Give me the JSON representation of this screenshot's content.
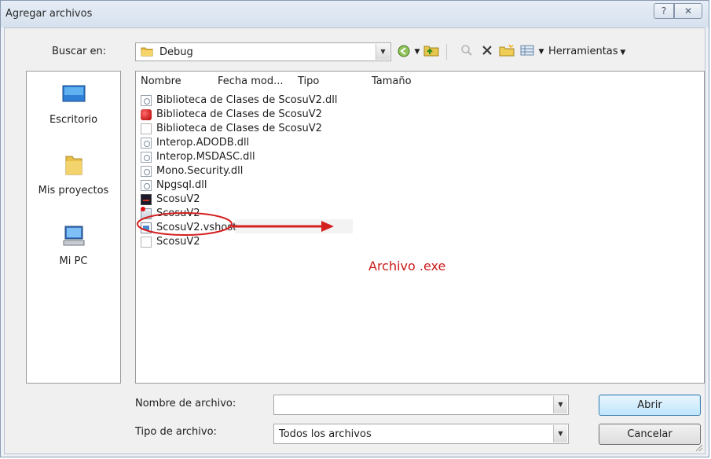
{
  "window": {
    "title": "Agregar archivos",
    "help_label": "?",
    "close_label": "✕"
  },
  "look_in": {
    "label": "Buscar en:",
    "value": "Debug"
  },
  "toolbar": {
    "tools_label": "Herramientas"
  },
  "places": [
    {
      "label": "Escritorio"
    },
    {
      "label": "Mis proyectos"
    },
    {
      "label": "Mi PC"
    }
  ],
  "columns": [
    "Nombre",
    "Fecha mod...",
    "Tipo",
    "Tamaño"
  ],
  "files": [
    {
      "name": "Biblioteca de Clases de ScosuV2.dll",
      "icon": "dll-file-icon"
    },
    {
      "name": "Biblioteca de Clases de ScosuV2",
      "icon": "debug-symbols-icon"
    },
    {
      "name": "Biblioteca de Clases de ScosuV2",
      "icon": "blank-file-icon"
    },
    {
      "name": "Interop.ADODB.dll",
      "icon": "dll-file-icon"
    },
    {
      "name": "Interop.MSDASC.dll",
      "icon": "dll-file-icon"
    },
    {
      "name": "Mono.Security.dll",
      "icon": "dll-file-icon"
    },
    {
      "name": "Npgsql.dll",
      "icon": "dll-file-icon"
    },
    {
      "name": "ScosuV2",
      "icon": "application-exe-icon"
    },
    {
      "name": "ScosuV2",
      "icon": "config-file-icon"
    },
    {
      "name": "ScosuV2.vshost",
      "icon": "vshost-app-icon"
    },
    {
      "name": "ScosuV2",
      "icon": "blank-file-icon"
    }
  ],
  "annotation": {
    "text": "Archivo .exe",
    "color": "#cc1b1b"
  },
  "filename": {
    "label": "Nombre de archivo:",
    "value": ""
  },
  "filetype": {
    "label": "Tipo de archivo:",
    "value": "Todos los archivos"
  },
  "buttons": {
    "open": "Abrir",
    "cancel": "Cancelar"
  }
}
